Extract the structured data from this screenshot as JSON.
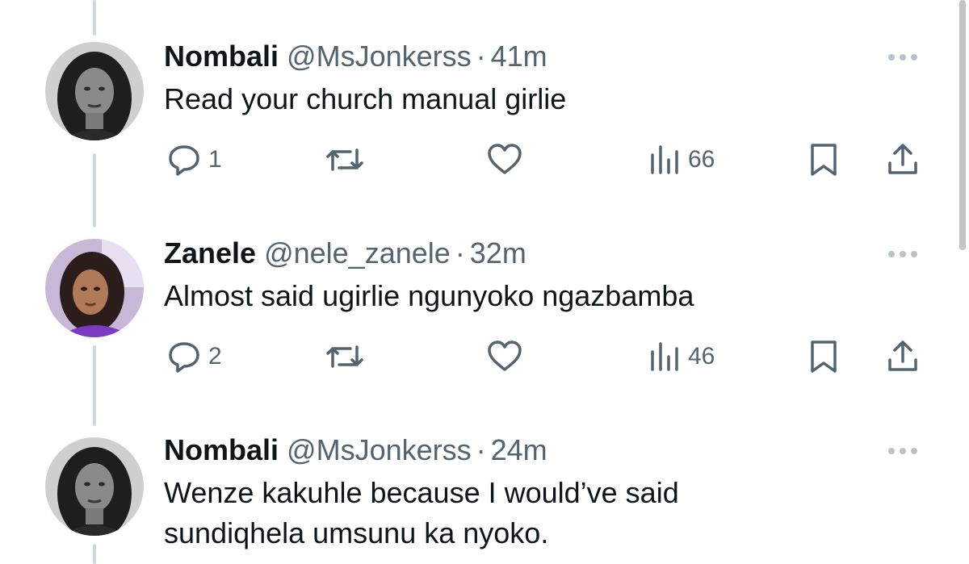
{
  "tweets": [
    {
      "name": "Nombali",
      "handle": "@MsJonkerss",
      "separator": "·",
      "time": "41m",
      "text": "Read your church manual girlie",
      "replies": "1",
      "views": "66"
    },
    {
      "name": "Zanele",
      "handle": "@nele_zanele",
      "separator": "·",
      "time": "32m",
      "text": "Almost said ugirlie ngunyoko ngazbamba",
      "replies": "2",
      "views": "46"
    },
    {
      "name": "Nombali",
      "handle": "@MsJonkerss",
      "separator": "·",
      "time": "24m",
      "text_line1": "Wenze kakuhle because I would’ve said",
      "text_line2": "sundiqhela umsunu ka nyoko."
    }
  ],
  "icons": {
    "reply": "reply-icon",
    "retweet": "retweet-icon",
    "like": "like-icon",
    "views": "views-icon",
    "bookmark": "bookmark-icon",
    "share": "share-icon",
    "more": "more-options-icon"
  },
  "colors": {
    "text": "#0f1419",
    "secondary": "#536471",
    "connector": "#cfd9de"
  }
}
